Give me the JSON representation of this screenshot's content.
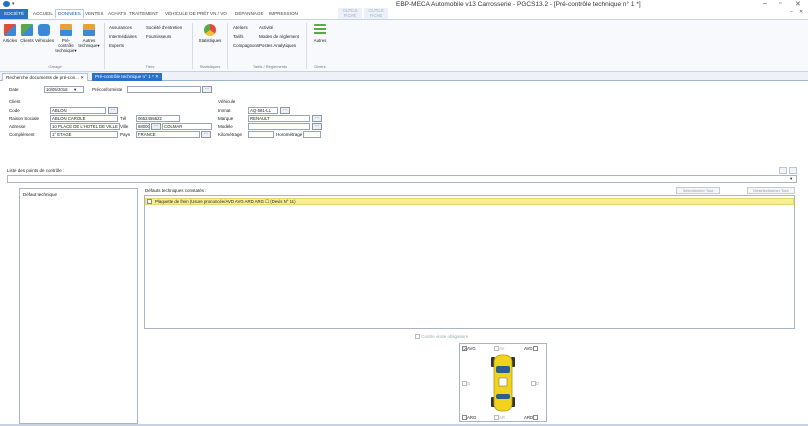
{
  "window": {
    "title": "EBP-MECA Automobile v13 Carrosserie - PGCS13.2 - [Pré-contrôle technique n° 1 *]",
    "qa_arrow": "▾",
    "min": "–",
    "restore": "▫",
    "close": "✕",
    "child_min": "–",
    "child_close": "✕"
  },
  "ribbon_tabs": {
    "societe": "SOCIÉTÉ",
    "accueil": "ACCUEIL",
    "donnees": "DONNÉES",
    "ventes": "VENTES",
    "achats": "ACHATS",
    "traitement": "TRAITEMENT",
    "vehicules_pret": "VÉHICULE DE PRÊT",
    "vn_vo": "VN / VO",
    "depannage": "DÉPANNAGE",
    "impression": "IMPRESSION",
    "ctx1_top": "OUTILS",
    "ctx1_bottom": "FICHE",
    "ctx2_top": "OUTILS",
    "ctx2_bottom": "FICHE"
  },
  "ribbon": {
    "garage": {
      "articles": "Articles",
      "clients": "Clients",
      "vehicules": "Véhicules",
      "precontrole": "Pré-contrôle technique▾",
      "autres": "Autres technique▾",
      "label": "Garage"
    },
    "tiers": {
      "assurances": "Assurances",
      "societe_entretien": "Société d'entretien",
      "intermediaires": "Intermédiaires",
      "fournisseurs": "Fournisseurs",
      "experts": "Experts",
      "label": "Tiers"
    },
    "statistiques": {
      "btn": "Statistiques",
      "label": "Statistiques"
    },
    "tarifs": {
      "ateliers": "Ateliers",
      "activite": "Activité",
      "tarifs": "Tarifs",
      "modes_reglement": "Modes de règlement",
      "compagnons": "Compagnons",
      "postes_analytiques": "Postes Analytiques",
      "label": "Tarifs / Règlements"
    },
    "divers": {
      "autres": "Autres",
      "label": "Divers"
    }
  },
  "doc_tabs": {
    "tab1": "Recherche documents de pré-con... ✕",
    "tab2": "Pré-contrôle technique n° 1 * ✕"
  },
  "form": {
    "date_label": "Date",
    "date_value": "10/05/2016",
    "preconformiste_label": "Préconformiste",
    "preconformiste_value": "",
    "client_section": "Client",
    "code_label": "Code",
    "code_value": "ABLON",
    "raison_label": "Raison Sociale",
    "raison_value": "ABLON CAROLE",
    "tel_label": "Tél",
    "tel_value": "0652455622",
    "adresse_label": "Adresse",
    "adresse_value": "10 PLACE DE L'HOTEL DE VILLE",
    "ville_label": "Ville",
    "cp_value": "68000",
    "ville_value": "COLMAR",
    "complement_label": "Complément",
    "complement_value": "1° ETAGE",
    "pays_label": "Pays",
    "pays_value": "FRANCE",
    "vehicule_section": "Véhicule",
    "immat_label": "Immat",
    "immat_value": "AQ-581-LL",
    "marque_label": "Marque",
    "marque_value": "RENAULT",
    "modele_label": "Modèle",
    "modele_value": "",
    "km_label": "Kilométrage",
    "km_value": "",
    "horometrage_label": "Horométrage",
    "horometrage_value": ""
  },
  "points": {
    "label": "Liste des points de contrôle :",
    "dropdown_arrow": "▾"
  },
  "defaults": {
    "left_header": "Défaut technique",
    "right_header": "Défauts techniques constatés :",
    "select_all": "Sélectionner Tout",
    "deselect_all": "Désélectionner Tout",
    "row_text": "Plaquette de frein (Usure prononcée/AVD AVG ARD ARG ☐ (Devis N° 11)"
  },
  "car": {
    "contre_visite": "Contre visite obligatoire",
    "avg": "AVG",
    "av": "AV",
    "avd": "AVD",
    "g": "G",
    "d": "D",
    "arg": "ARG",
    "ar": "AR",
    "ard": "ARD"
  },
  "colors": {
    "accent": "#2a71c8",
    "defect_row": "#f7ef92",
    "car_body": "#f1d21c"
  }
}
